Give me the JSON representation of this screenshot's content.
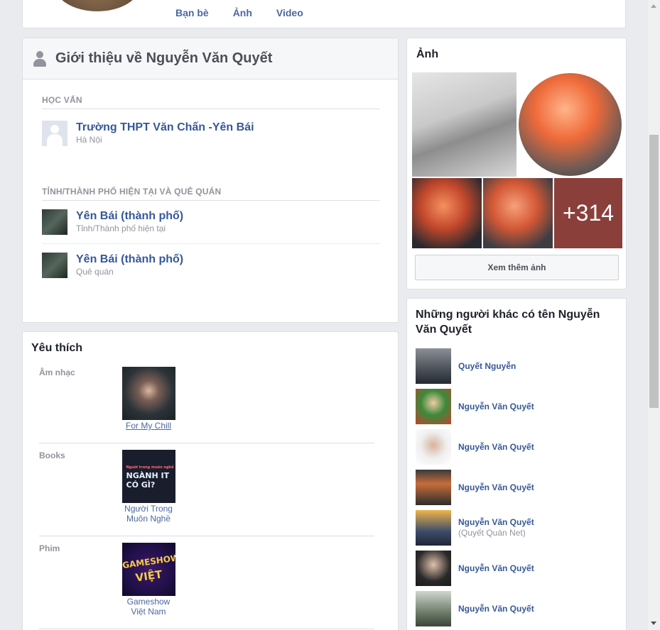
{
  "nav": {
    "friends": "Bạn bè",
    "photos": "Ảnh",
    "videos": "Video"
  },
  "intro": {
    "title": "Giới thiệu về Nguyễn Văn Quyết",
    "education_label": "HỌC VẤN",
    "school": {
      "name": "Trường THPT Văn Chấn -Yên Bái",
      "location": "Hà Nội"
    },
    "places_label": "TỈNH/THÀNH PHỐ HIỆN TẠI VÀ QUÊ QUÁN",
    "places": [
      {
        "name": "Yên Bái (thành phố)",
        "type": "Tỉnh/Thành phố hiện tại"
      },
      {
        "name": "Yên Bái (thành phố)",
        "type": "Quê quán"
      }
    ]
  },
  "likes": {
    "title": "Yêu thích",
    "categories": [
      {
        "label": "Âm nhạc",
        "item": "For My Chill"
      },
      {
        "label": "Books",
        "item": "Người Trong Muôn Nghề",
        "cover_lines": [
          "Người trong muôn nghề",
          "NGÀNH IT",
          "CÓ GÌ?"
        ]
      },
      {
        "label": "Phim",
        "item": "Gameshow Việt Nam",
        "cover_lines": [
          "GAMESHOW",
          "VIỆT"
        ]
      }
    ]
  },
  "photos": {
    "title": "Ảnh",
    "more_count": "+314",
    "see_more": "Xem thêm ảnh"
  },
  "others": {
    "title": "Những người khác có tên Nguyễn Văn Quyết",
    "people": [
      {
        "name": "Quyết Nguyễn",
        "sub": ""
      },
      {
        "name": "Nguyễn Văn Quyết",
        "sub": ""
      },
      {
        "name": "Nguyễn Văn Quyết",
        "sub": ""
      },
      {
        "name": "Nguyễn Văn Quyết",
        "sub": ""
      },
      {
        "name": "Nguyễn Văn Quyết",
        "sub": "(Quyết Quán Net)"
      },
      {
        "name": "Nguyễn Văn Quyết",
        "sub": ""
      },
      {
        "name": "Nguyễn Văn Quyết",
        "sub": ""
      }
    ]
  },
  "colors": {
    "link": "#365899",
    "nav": "#4b67a1",
    "muted": "#90949c",
    "background": "#e9ebee"
  },
  "icons": [
    "person-icon",
    "school-placeholder-icon",
    "scroll-up-icon",
    "scroll-down-icon"
  ]
}
